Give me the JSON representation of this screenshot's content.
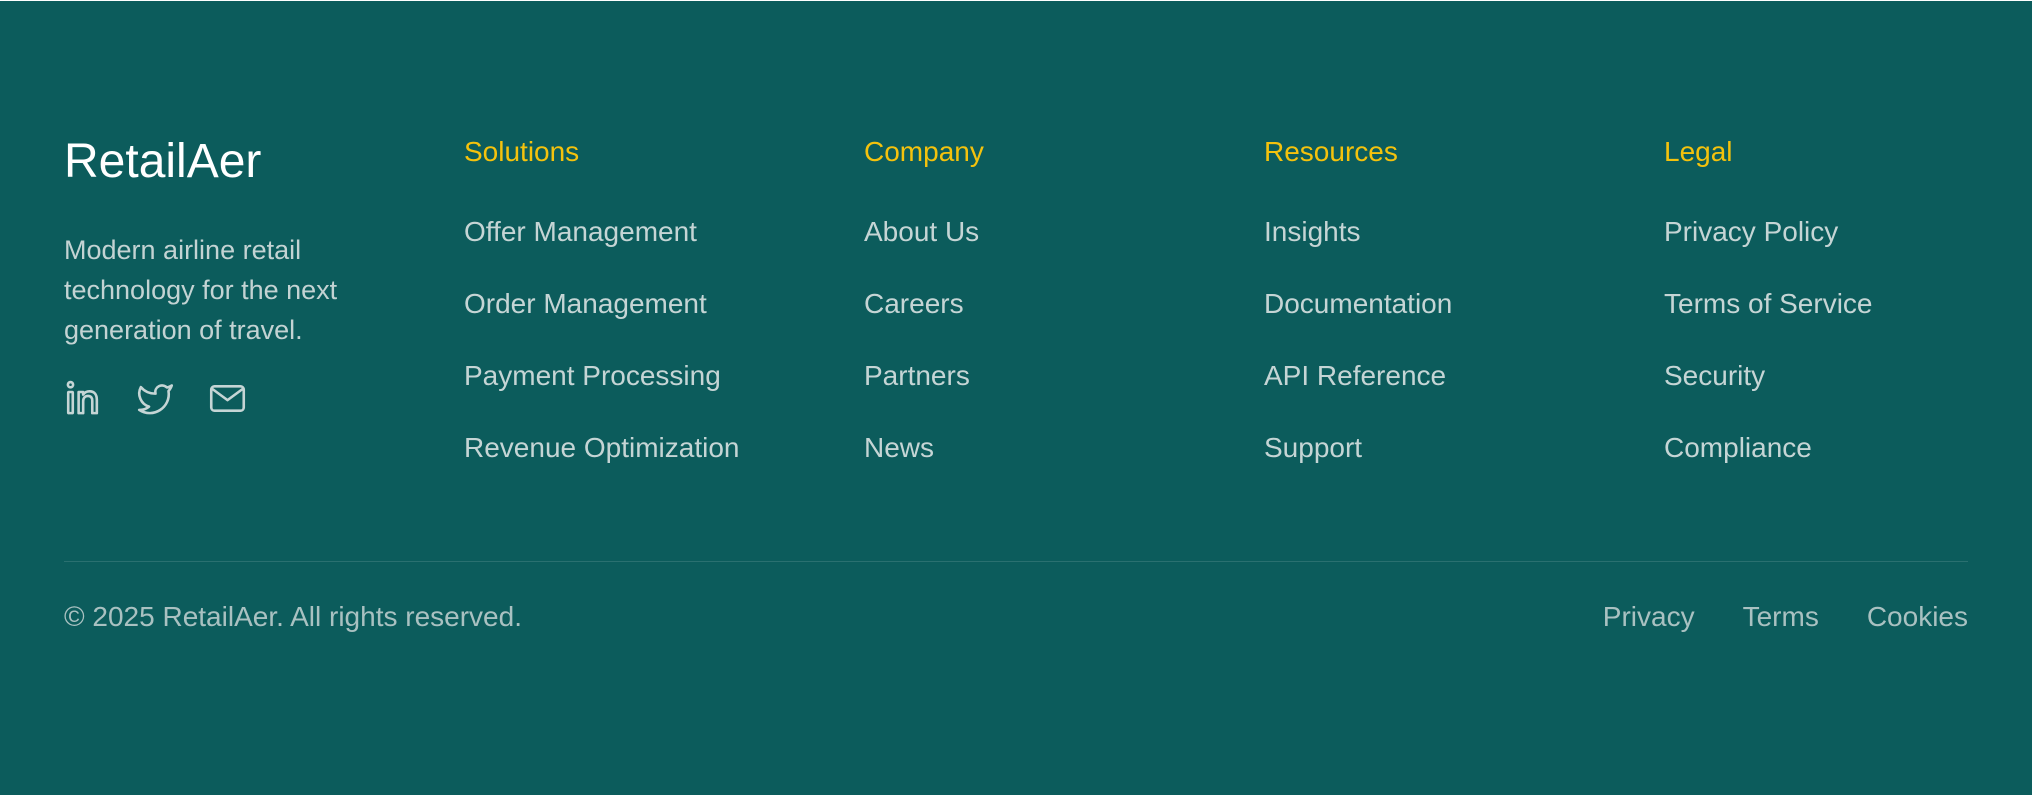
{
  "brand": {
    "name": "RetailAer",
    "tagline": "Modern airline retail technology for the next generation of travel."
  },
  "social": [
    {
      "icon": "linkedin-icon"
    },
    {
      "icon": "twitter-icon"
    },
    {
      "icon": "mail-icon"
    }
  ],
  "columns": [
    {
      "heading": "Solutions",
      "links": [
        "Offer Management",
        "Order Management",
        "Payment Processing",
        "Revenue Optimization"
      ]
    },
    {
      "heading": "Company",
      "links": [
        "About Us",
        "Careers",
        "Partners",
        "News"
      ]
    },
    {
      "heading": "Resources",
      "links": [
        "Insights",
        "Documentation",
        "API Reference",
        "Support"
      ]
    },
    {
      "heading": "Legal",
      "links": [
        "Privacy Policy",
        "Terms of Service",
        "Security",
        "Compliance"
      ]
    }
  ],
  "bottom": {
    "copyright": "© 2025 RetailAer. All rights reserved.",
    "links": [
      "Privacy",
      "Terms",
      "Cookies"
    ]
  },
  "colors": {
    "background": "#0c5c5c",
    "heading_accent": "#f4c20d",
    "link_text": "#c5d5d5"
  }
}
